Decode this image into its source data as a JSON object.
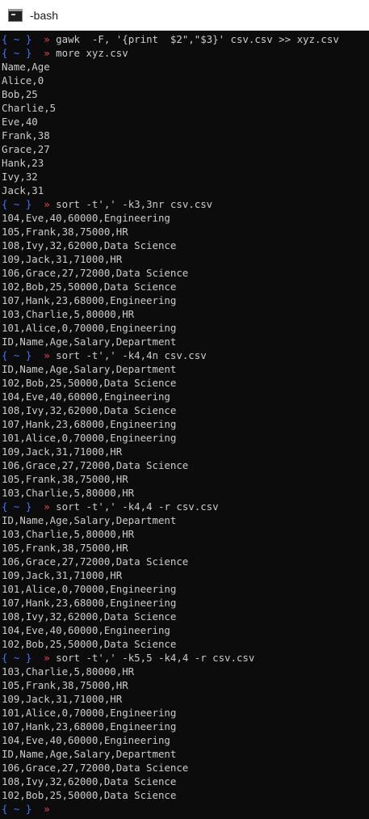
{
  "window": {
    "title": "-bash",
    "icon": "terminal-icon"
  },
  "colors": {
    "background": "#0c0c0c",
    "text": "#cccccc",
    "prompt_brace": "#3b78ff",
    "prompt_arrow": "#e74856"
  },
  "prompt": {
    "dir": "{ ~ }",
    "arrow": "»"
  },
  "lines": [
    {
      "type": "cmd",
      "text": "gawk  -F, '{print  $2\",\"$3}' csv.csv >> xyz.csv"
    },
    {
      "type": "cmd",
      "text": "more xyz.csv"
    },
    {
      "type": "out",
      "text": "Name,Age"
    },
    {
      "type": "out",
      "text": "Alice,0"
    },
    {
      "type": "out",
      "text": "Bob,25"
    },
    {
      "type": "out",
      "text": "Charlie,5"
    },
    {
      "type": "out",
      "text": "Eve,40"
    },
    {
      "type": "out",
      "text": "Frank,38"
    },
    {
      "type": "out",
      "text": "Grace,27"
    },
    {
      "type": "out",
      "text": "Hank,23"
    },
    {
      "type": "out",
      "text": "Ivy,32"
    },
    {
      "type": "out",
      "text": "Jack,31"
    },
    {
      "type": "cmd",
      "text": "sort -t',' -k3,3nr csv.csv"
    },
    {
      "type": "out",
      "text": "104,Eve,40,60000,Engineering"
    },
    {
      "type": "out",
      "text": "105,Frank,38,75000,HR"
    },
    {
      "type": "out",
      "text": "108,Ivy,32,62000,Data Science"
    },
    {
      "type": "out",
      "text": "109,Jack,31,71000,HR"
    },
    {
      "type": "out",
      "text": "106,Grace,27,72000,Data Science"
    },
    {
      "type": "out",
      "text": "102,Bob,25,50000,Data Science"
    },
    {
      "type": "out",
      "text": "107,Hank,23,68000,Engineering"
    },
    {
      "type": "out",
      "text": "103,Charlie,5,80000,HR"
    },
    {
      "type": "out",
      "text": "101,Alice,0,70000,Engineering"
    },
    {
      "type": "out",
      "text": "ID,Name,Age,Salary,Department"
    },
    {
      "type": "cmd",
      "text": "sort -t',' -k4,4n csv.csv"
    },
    {
      "type": "out",
      "text": "ID,Name,Age,Salary,Department"
    },
    {
      "type": "out",
      "text": "102,Bob,25,50000,Data Science"
    },
    {
      "type": "out",
      "text": "104,Eve,40,60000,Engineering"
    },
    {
      "type": "out",
      "text": "108,Ivy,32,62000,Data Science"
    },
    {
      "type": "out",
      "text": "107,Hank,23,68000,Engineering"
    },
    {
      "type": "out",
      "text": "101,Alice,0,70000,Engineering"
    },
    {
      "type": "out",
      "text": "109,Jack,31,71000,HR"
    },
    {
      "type": "out",
      "text": "106,Grace,27,72000,Data Science"
    },
    {
      "type": "out",
      "text": "105,Frank,38,75000,HR"
    },
    {
      "type": "out",
      "text": "103,Charlie,5,80000,HR"
    },
    {
      "type": "cmd",
      "text": "sort -t',' -k4,4 -r csv.csv"
    },
    {
      "type": "out",
      "text": "ID,Name,Age,Salary,Department"
    },
    {
      "type": "out",
      "text": "103,Charlie,5,80000,HR"
    },
    {
      "type": "out",
      "text": "105,Frank,38,75000,HR"
    },
    {
      "type": "out",
      "text": "106,Grace,27,72000,Data Science"
    },
    {
      "type": "out",
      "text": "109,Jack,31,71000,HR"
    },
    {
      "type": "out",
      "text": "101,Alice,0,70000,Engineering"
    },
    {
      "type": "out",
      "text": "107,Hank,23,68000,Engineering"
    },
    {
      "type": "out",
      "text": "108,Ivy,32,62000,Data Science"
    },
    {
      "type": "out",
      "text": "104,Eve,40,60000,Engineering"
    },
    {
      "type": "out",
      "text": "102,Bob,25,50000,Data Science"
    },
    {
      "type": "cmd",
      "text": "sort -t',' -k5,5 -k4,4 -r csv.csv"
    },
    {
      "type": "out",
      "text": "103,Charlie,5,80000,HR"
    },
    {
      "type": "out",
      "text": "105,Frank,38,75000,HR"
    },
    {
      "type": "out",
      "text": "109,Jack,31,71000,HR"
    },
    {
      "type": "out",
      "text": "101,Alice,0,70000,Engineering"
    },
    {
      "type": "out",
      "text": "107,Hank,23,68000,Engineering"
    },
    {
      "type": "out",
      "text": "104,Eve,40,60000,Engineering"
    },
    {
      "type": "out",
      "text": "ID,Name,Age,Salary,Department"
    },
    {
      "type": "out",
      "text": "106,Grace,27,72000,Data Science"
    },
    {
      "type": "out",
      "text": "108,Ivy,32,62000,Data Science"
    },
    {
      "type": "out",
      "text": "102,Bob,25,50000,Data Science"
    },
    {
      "type": "cmd",
      "text": ""
    }
  ]
}
